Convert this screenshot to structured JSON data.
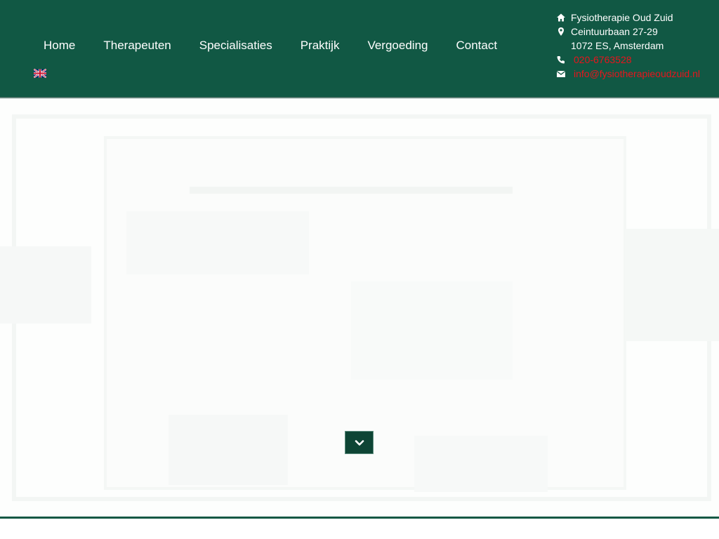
{
  "nav": {
    "items": [
      {
        "label": "Home"
      },
      {
        "label": "Therapeuten"
      },
      {
        "label": "Specialisaties"
      },
      {
        "label": "Praktijk"
      },
      {
        "label": "Vergoeding"
      },
      {
        "label": "Contact"
      }
    ],
    "language_flag_icon": "uk-flag-icon"
  },
  "contact": {
    "name": "Fysiotherapie Oud Zuid",
    "street": "Ceintuurbaan 27-29",
    "city": "1072 ES, Amsterdam",
    "phone": "020-6763528",
    "email": "info@fysiotherapieoudzuid.nl",
    "icons": [
      "home-icon",
      "map-marker-icon",
      "phone-icon",
      "envelope-icon"
    ]
  },
  "hero": {
    "scroll_icon": "chevron-down-icon"
  },
  "colors": {
    "brand_green": "#115844",
    "dark_green": "#0e4535",
    "link_red": "#e8141c",
    "text_white": "#ffffff"
  }
}
